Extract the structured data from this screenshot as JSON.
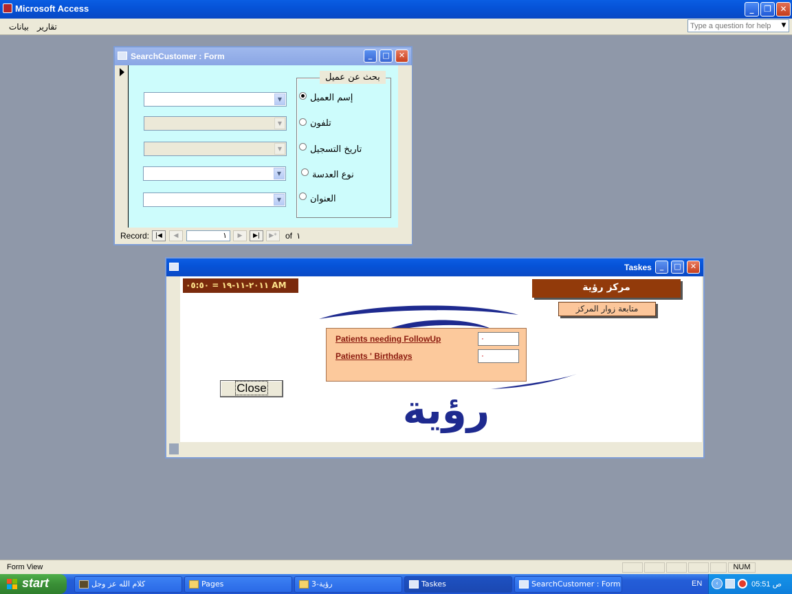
{
  "app": {
    "title": "Microsoft Access",
    "menu": [
      "بيانات",
      "تقارير"
    ],
    "help_placeholder": "Type a question for help"
  },
  "search_form": {
    "title": "SearchCustomer : Form",
    "frame_label": "بحث عن عميل",
    "options": [
      {
        "label": "إسم العميل",
        "checked": true
      },
      {
        "label": "تلفون",
        "checked": false
      },
      {
        "label": "تاريخ التسجيل",
        "checked": false
      },
      {
        "label": "نوع العدسة",
        "checked": false
      },
      {
        "label": "العنوان",
        "checked": false
      }
    ],
    "combos": [
      {
        "value": "",
        "enabled": true
      },
      {
        "value": "",
        "enabled": false
      },
      {
        "value": "",
        "enabled": false
      },
      {
        "value": "",
        "enabled": true
      },
      {
        "value": "",
        "enabled": true
      }
    ],
    "nav": {
      "label": "Record:",
      "current": "١",
      "of_label": "of",
      "total": "١"
    }
  },
  "tasks_form": {
    "title": "Taskes",
    "datetime": "٢٠١١-١١-١٩  =  ٠٥:٥٠ AM",
    "center_title": "مركز رؤية",
    "visitors_button": "متابعة زوار المركز",
    "logo_text": "رؤية",
    "links": [
      {
        "label": "Patients needing FollowUp",
        "count": "٠"
      },
      {
        "label": "Patients ' Birthdays",
        "count": "٠"
      }
    ],
    "close_label": "Close"
  },
  "status": {
    "view": "Form View",
    "num": "NUM"
  },
  "taskbar": {
    "start_label": "start",
    "items": [
      {
        "label": "كلام الله عز وجل",
        "active": false
      },
      {
        "label": "Pages",
        "active": false
      },
      {
        "label": "رؤية-3",
        "active": false
      },
      {
        "label": "Taskes",
        "active": true
      },
      {
        "label": "SearchCustomer : Form",
        "active": false
      }
    ],
    "language": "EN",
    "clock": "05:51 ص"
  },
  "colors": {
    "desktop": "#8f98a9",
    "form_bg": "#cdfcfc",
    "brand": "#923a0a",
    "accent_peach": "#fcc99c"
  }
}
